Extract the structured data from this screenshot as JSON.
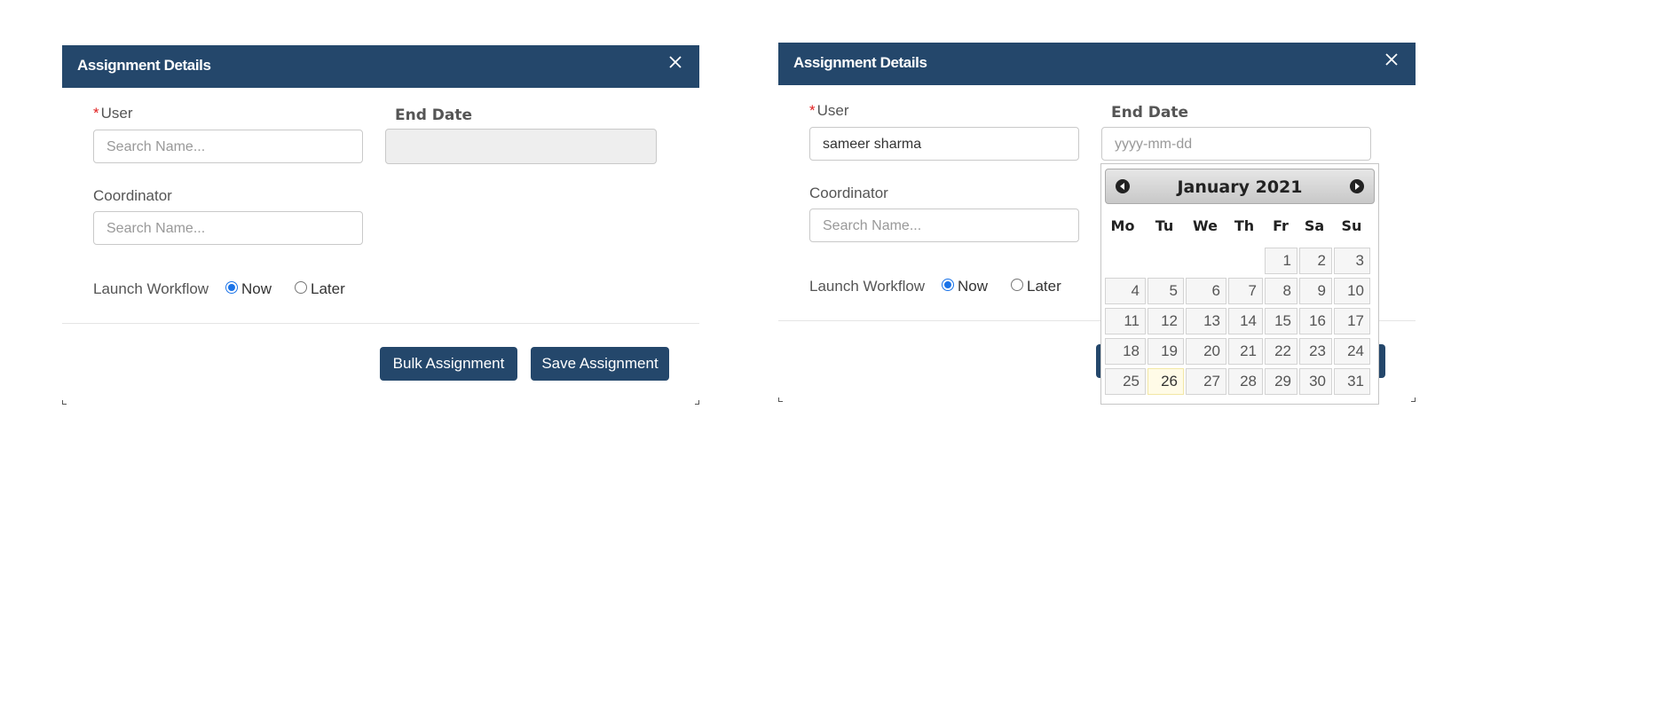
{
  "dialog_left": {
    "title": "Assignment Details",
    "user_label": "User",
    "required_mark": "*",
    "user_placeholder": "Search Name...",
    "end_date_label": "End Date",
    "coordinator_label": "Coordinator",
    "coordinator_placeholder": "Search Name...",
    "launch_workflow_label": "Launch Workflow",
    "radio_now": "Now",
    "radio_later": "Later",
    "bulk_button": "Bulk Assignment",
    "save_button": "Save Assignment"
  },
  "dialog_right": {
    "title": "Assignment Details",
    "user_label": "User",
    "required_mark": "*",
    "user_value": "sameer sharma",
    "end_date_label": "End Date",
    "end_date_placeholder": "yyyy-mm-dd",
    "coordinator_label": "Coordinator",
    "coordinator_placeholder": "Search Name...",
    "launch_workflow_label": "Launch Workflow",
    "radio_now": "Now",
    "radio_later": "Later"
  },
  "datepicker": {
    "month_year": "January 2021",
    "weekdays": [
      "Mo",
      "Tu",
      "We",
      "Th",
      "Fr",
      "Sa",
      "Su"
    ],
    "weeks": [
      [
        "",
        "",
        "",
        "",
        "1",
        "2",
        "3"
      ],
      [
        "4",
        "5",
        "6",
        "7",
        "8",
        "9",
        "10"
      ],
      [
        "11",
        "12",
        "13",
        "14",
        "15",
        "16",
        "17"
      ],
      [
        "18",
        "19",
        "20",
        "21",
        "22",
        "23",
        "24"
      ],
      [
        "25",
        "26",
        "27",
        "28",
        "29",
        "30",
        "31"
      ]
    ],
    "today": "26"
  },
  "colors": {
    "header_bg": "#24476b",
    "accent_radio": "#1a73e8",
    "required": "#e02020"
  },
  "icons": {
    "close": "close-icon",
    "prev": "prev-month-icon",
    "next": "next-month-icon"
  }
}
